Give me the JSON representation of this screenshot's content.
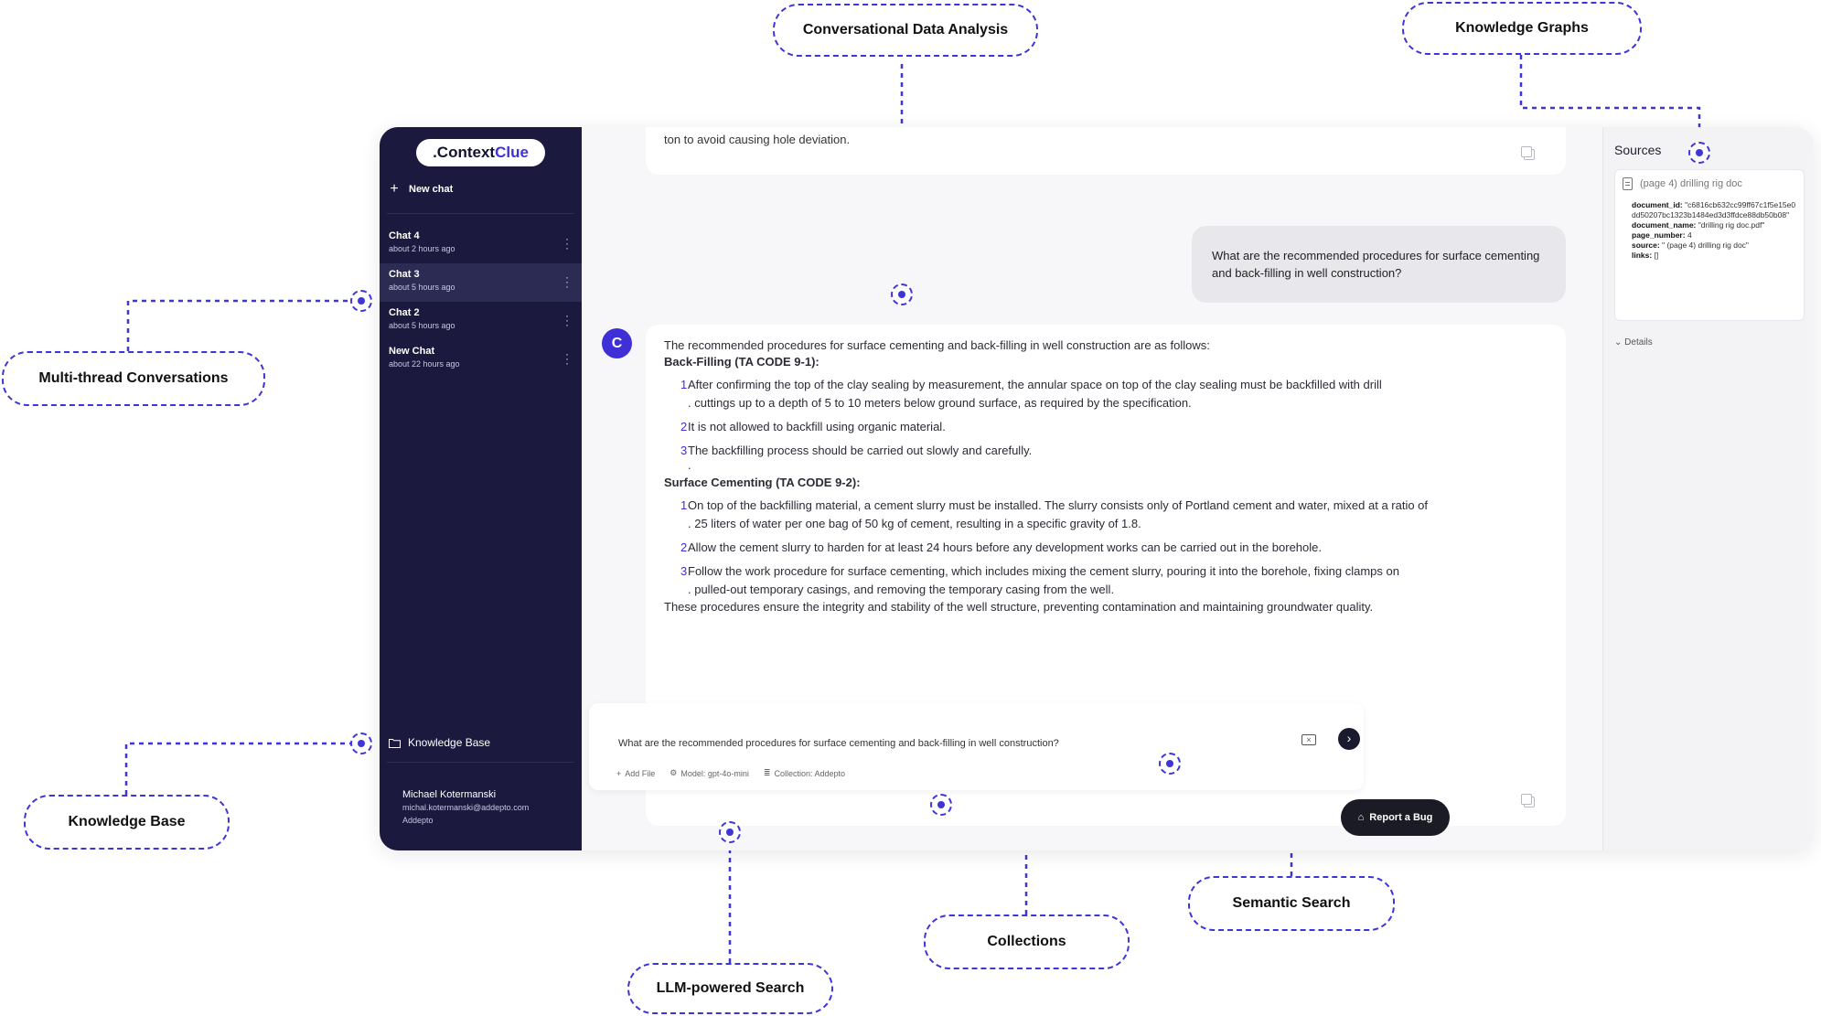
{
  "app": {
    "logo_prefix": ".Context",
    "logo_highlight": "Clue",
    "brand_color": "#3e2fd6"
  },
  "sidebar": {
    "new_chat": "New chat",
    "chats": [
      {
        "title": "Chat 4",
        "time": "about 2 hours ago"
      },
      {
        "title": "Chat 3",
        "time": "about 5 hours ago"
      },
      {
        "title": "Chat 2",
        "time": "about 5 hours ago"
      },
      {
        "title": "New Chat",
        "time": "about 22 hours ago"
      }
    ],
    "knowledge_base": "Knowledge Base",
    "user": {
      "name": "Michael Kotermanski",
      "email": "michal.kotermanski@addepto.com",
      "org": "Addepto"
    }
  },
  "chat": {
    "prev_tail": "ton to avoid causing hole deviation.",
    "user_question": "What are the recommended procedures for surface cementing and back-filling in well construction?",
    "avatar_letter": "C",
    "answer": {
      "intro": "The recommended procedures for surface cementing and back-filling in well construction are as follows:",
      "section1_title": "Back-Filling (TA CODE 9-1):",
      "section1_steps": [
        {
          "n": "1",
          "line1": "After confirming the top of the clay sealing by measurement, the annular space on top of the clay sealing must be backfilled with drill",
          "line2": ". cuttings up to a depth of 5 to 10 meters below ground surface, as required by the specification."
        },
        {
          "n": "2",
          "line1": "It is not allowed to backfill using organic material.",
          "line2": ""
        },
        {
          "n": "3",
          "line1": "The backfilling process should be carried out slowly and carefully.",
          "line2": "."
        }
      ],
      "section2_title": "Surface Cementing (TA CODE 9-2):",
      "section2_steps": [
        {
          "n": "1",
          "line1": "On top of the backfilling material, a cement slurry must be installed. The slurry consists only of Portland cement and water, mixed at a ratio of",
          "line2": ". 25 liters of water per one bag of 50 kg of cement, resulting in a specific gravity of 1.8."
        },
        {
          "n": "2",
          "line1": "Allow the cement slurry to harden for at least 24 hours before any development works can be carried out in the borehole.",
          "line2": ""
        },
        {
          "n": "3",
          "line1": "Follow the work procedure for surface cementing, which includes mixing the cement slurry, pouring it into the borehole, fixing clamps on",
          "line2": ". pulled-out temporary casings, and removing the temporary casing from the well."
        }
      ],
      "outro": "These procedures ensure the integrity and stability of the well structure, preventing contamination and maintaining groundwater quality."
    },
    "input": {
      "value": "What are the recommended procedures for surface cementing and back-filling in well construction?",
      "add_file": "Add File",
      "model": "Model: gpt-4o-mini",
      "collection": "Collection: Addepto"
    }
  },
  "sources": {
    "title": "Sources",
    "item_title": "(page 4) drilling rig doc",
    "fields": [
      {
        "key": "document_id:",
        "value": " \"c6816cb632cc99ff67c1f5e15e0dd50207bc1323b1484ed3d3ffdce88db50b08\""
      },
      {
        "key": "document_name:",
        "value": " \"drilling rig doc.pdf\""
      },
      {
        "key": "page_number:",
        "value": " 4"
      },
      {
        "key": "source:",
        "value": " \" (page 4) drilling rig doc\""
      },
      {
        "key": "links:",
        "value": " []"
      }
    ],
    "details": "Details",
    "report_bug": "Report a Bug"
  },
  "callouts": {
    "conversational": "Conversational Data Analysis",
    "knowledge_graphs": "Knowledge Graphs",
    "multithread": "Multi-thread Conversations",
    "knowledge_base": "Knowledge Base",
    "semantic": "Semantic Search",
    "collections": "Collections",
    "llm": "LLM-powered Search"
  },
  "callout_color": "#3e35d8"
}
